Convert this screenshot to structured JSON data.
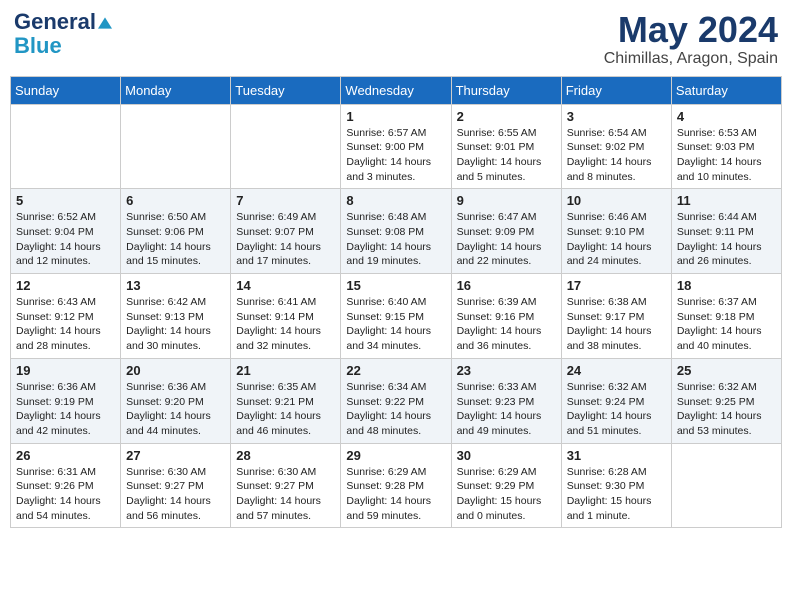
{
  "header": {
    "logo_line1": "General",
    "logo_line2": "Blue",
    "month_title": "May 2024",
    "location": "Chimillas, Aragon, Spain"
  },
  "days_of_week": [
    "Sunday",
    "Monday",
    "Tuesday",
    "Wednesday",
    "Thursday",
    "Friday",
    "Saturday"
  ],
  "weeks": [
    [
      {
        "day": "",
        "sunrise": "",
        "sunset": "",
        "daylight": ""
      },
      {
        "day": "",
        "sunrise": "",
        "sunset": "",
        "daylight": ""
      },
      {
        "day": "",
        "sunrise": "",
        "sunset": "",
        "daylight": ""
      },
      {
        "day": "1",
        "sunrise": "Sunrise: 6:57 AM",
        "sunset": "Sunset: 9:00 PM",
        "daylight": "Daylight: 14 hours and 3 minutes."
      },
      {
        "day": "2",
        "sunrise": "Sunrise: 6:55 AM",
        "sunset": "Sunset: 9:01 PM",
        "daylight": "Daylight: 14 hours and 5 minutes."
      },
      {
        "day": "3",
        "sunrise": "Sunrise: 6:54 AM",
        "sunset": "Sunset: 9:02 PM",
        "daylight": "Daylight: 14 hours and 8 minutes."
      },
      {
        "day": "4",
        "sunrise": "Sunrise: 6:53 AM",
        "sunset": "Sunset: 9:03 PM",
        "daylight": "Daylight: 14 hours and 10 minutes."
      }
    ],
    [
      {
        "day": "5",
        "sunrise": "Sunrise: 6:52 AM",
        "sunset": "Sunset: 9:04 PM",
        "daylight": "Daylight: 14 hours and 12 minutes."
      },
      {
        "day": "6",
        "sunrise": "Sunrise: 6:50 AM",
        "sunset": "Sunset: 9:06 PM",
        "daylight": "Daylight: 14 hours and 15 minutes."
      },
      {
        "day": "7",
        "sunrise": "Sunrise: 6:49 AM",
        "sunset": "Sunset: 9:07 PM",
        "daylight": "Daylight: 14 hours and 17 minutes."
      },
      {
        "day": "8",
        "sunrise": "Sunrise: 6:48 AM",
        "sunset": "Sunset: 9:08 PM",
        "daylight": "Daylight: 14 hours and 19 minutes."
      },
      {
        "day": "9",
        "sunrise": "Sunrise: 6:47 AM",
        "sunset": "Sunset: 9:09 PM",
        "daylight": "Daylight: 14 hours and 22 minutes."
      },
      {
        "day": "10",
        "sunrise": "Sunrise: 6:46 AM",
        "sunset": "Sunset: 9:10 PM",
        "daylight": "Daylight: 14 hours and 24 minutes."
      },
      {
        "day": "11",
        "sunrise": "Sunrise: 6:44 AM",
        "sunset": "Sunset: 9:11 PM",
        "daylight": "Daylight: 14 hours and 26 minutes."
      }
    ],
    [
      {
        "day": "12",
        "sunrise": "Sunrise: 6:43 AM",
        "sunset": "Sunset: 9:12 PM",
        "daylight": "Daylight: 14 hours and 28 minutes."
      },
      {
        "day": "13",
        "sunrise": "Sunrise: 6:42 AM",
        "sunset": "Sunset: 9:13 PM",
        "daylight": "Daylight: 14 hours and 30 minutes."
      },
      {
        "day": "14",
        "sunrise": "Sunrise: 6:41 AM",
        "sunset": "Sunset: 9:14 PM",
        "daylight": "Daylight: 14 hours and 32 minutes."
      },
      {
        "day": "15",
        "sunrise": "Sunrise: 6:40 AM",
        "sunset": "Sunset: 9:15 PM",
        "daylight": "Daylight: 14 hours and 34 minutes."
      },
      {
        "day": "16",
        "sunrise": "Sunrise: 6:39 AM",
        "sunset": "Sunset: 9:16 PM",
        "daylight": "Daylight: 14 hours and 36 minutes."
      },
      {
        "day": "17",
        "sunrise": "Sunrise: 6:38 AM",
        "sunset": "Sunset: 9:17 PM",
        "daylight": "Daylight: 14 hours and 38 minutes."
      },
      {
        "day": "18",
        "sunrise": "Sunrise: 6:37 AM",
        "sunset": "Sunset: 9:18 PM",
        "daylight": "Daylight: 14 hours and 40 minutes."
      }
    ],
    [
      {
        "day": "19",
        "sunrise": "Sunrise: 6:36 AM",
        "sunset": "Sunset: 9:19 PM",
        "daylight": "Daylight: 14 hours and 42 minutes."
      },
      {
        "day": "20",
        "sunrise": "Sunrise: 6:36 AM",
        "sunset": "Sunset: 9:20 PM",
        "daylight": "Daylight: 14 hours and 44 minutes."
      },
      {
        "day": "21",
        "sunrise": "Sunrise: 6:35 AM",
        "sunset": "Sunset: 9:21 PM",
        "daylight": "Daylight: 14 hours and 46 minutes."
      },
      {
        "day": "22",
        "sunrise": "Sunrise: 6:34 AM",
        "sunset": "Sunset: 9:22 PM",
        "daylight": "Daylight: 14 hours and 48 minutes."
      },
      {
        "day": "23",
        "sunrise": "Sunrise: 6:33 AM",
        "sunset": "Sunset: 9:23 PM",
        "daylight": "Daylight: 14 hours and 49 minutes."
      },
      {
        "day": "24",
        "sunrise": "Sunrise: 6:32 AM",
        "sunset": "Sunset: 9:24 PM",
        "daylight": "Daylight: 14 hours and 51 minutes."
      },
      {
        "day": "25",
        "sunrise": "Sunrise: 6:32 AM",
        "sunset": "Sunset: 9:25 PM",
        "daylight": "Daylight: 14 hours and 53 minutes."
      }
    ],
    [
      {
        "day": "26",
        "sunrise": "Sunrise: 6:31 AM",
        "sunset": "Sunset: 9:26 PM",
        "daylight": "Daylight: 14 hours and 54 minutes."
      },
      {
        "day": "27",
        "sunrise": "Sunrise: 6:30 AM",
        "sunset": "Sunset: 9:27 PM",
        "daylight": "Daylight: 14 hours and 56 minutes."
      },
      {
        "day": "28",
        "sunrise": "Sunrise: 6:30 AM",
        "sunset": "Sunset: 9:27 PM",
        "daylight": "Daylight: 14 hours and 57 minutes."
      },
      {
        "day": "29",
        "sunrise": "Sunrise: 6:29 AM",
        "sunset": "Sunset: 9:28 PM",
        "daylight": "Daylight: 14 hours and 59 minutes."
      },
      {
        "day": "30",
        "sunrise": "Sunrise: 6:29 AM",
        "sunset": "Sunset: 9:29 PM",
        "daylight": "Daylight: 15 hours and 0 minutes."
      },
      {
        "day": "31",
        "sunrise": "Sunrise: 6:28 AM",
        "sunset": "Sunset: 9:30 PM",
        "daylight": "Daylight: 15 hours and 1 minute."
      },
      {
        "day": "",
        "sunrise": "",
        "sunset": "",
        "daylight": ""
      }
    ]
  ]
}
